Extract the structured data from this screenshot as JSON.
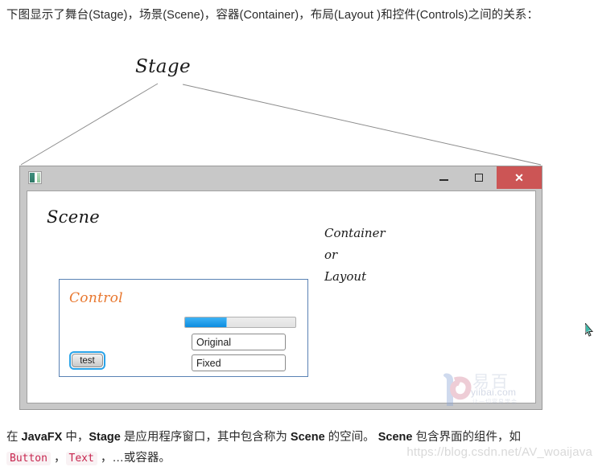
{
  "intro": {
    "text": "下图显示了舞台(Stage)，场景(Scene)，容器(Container)，布局(Layout )和控件(Controls)之间的关系："
  },
  "diagram": {
    "stage_label": "Stage",
    "scene_label": "Scene",
    "container_note_lines": [
      "Container",
      "or",
      "Layout"
    ],
    "control_label": "Control"
  },
  "window": {
    "minimize_label": "−",
    "maximize_label": "□",
    "close_label": "✕",
    "app_icon": "app-window-icon"
  },
  "controls": {
    "progress_percent": 38,
    "field_one_value": "Original",
    "field_two_value": "Fixed",
    "button_label": "test"
  },
  "watermark": {
    "brand_cn": "易百",
    "brand_url": "yiibai.com",
    "brand_tagline": "让一切容易学会",
    "blog_url": "https://blog.csdn.net/AV_woaijava"
  },
  "outro": {
    "seg1": "在 ",
    "b1": "JavaFX",
    "seg2": " 中，",
    "b2": "Stage",
    "seg3": " 是应用程序窗口，其中包含称为 ",
    "b3": "Scene",
    "seg4": " 的空间。 ",
    "b4": "Scene",
    "seg5": " 包含界面的组件，如",
    "code1": "Button",
    "seg6": " ，",
    "code2": "Text",
    "seg7": " ，…或容器。"
  },
  "colors": {
    "accent_orange": "#e8772e",
    "pane_border_blue": "#5a82b4",
    "progress_blue": "#0c8ce0",
    "close_red": "#cc5555",
    "titlebar_gray": "#c8c8c8"
  }
}
